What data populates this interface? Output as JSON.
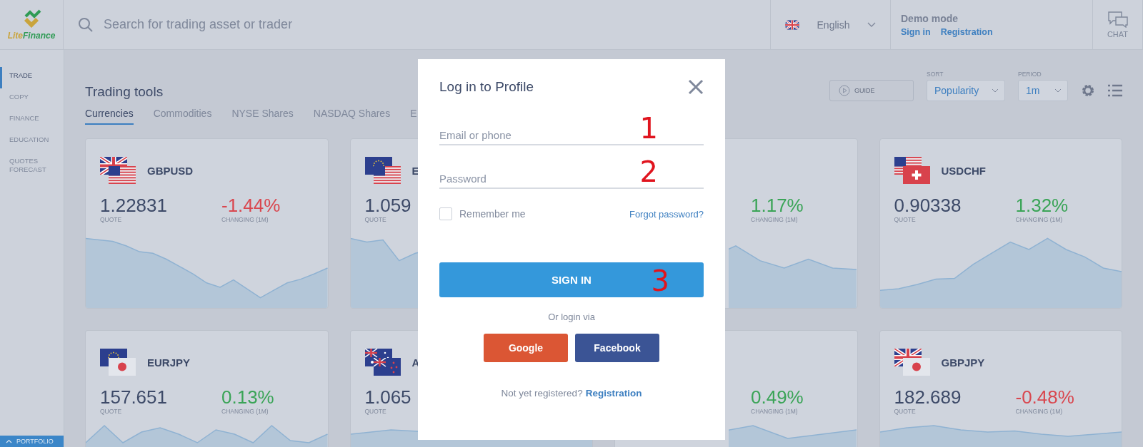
{
  "logo": {
    "parts": [
      "Lite",
      "Finance"
    ]
  },
  "search": {
    "placeholder": "Search for trading asset or trader"
  },
  "language": {
    "label": "English"
  },
  "account": {
    "mode": "Demo mode",
    "links": [
      "Sign in",
      "Registration"
    ]
  },
  "chat": {
    "label": "CHAT"
  },
  "sidebar": {
    "items": [
      {
        "label": "TRADE",
        "selected": true
      },
      {
        "label": "COPY",
        "selected": false
      },
      {
        "label": "FINANCE",
        "selected": false
      },
      {
        "label": "EDUCATION",
        "selected": false
      },
      {
        "label": "QUOTES FORECAST",
        "selected": false
      }
    ]
  },
  "portfolio": {
    "label": "PORTFOLIO"
  },
  "page": {
    "title": "Trading tools"
  },
  "tabs": [
    {
      "label": "Currencies",
      "selected": true
    },
    {
      "label": "Commodities",
      "selected": false
    },
    {
      "label": "NYSE Shares",
      "selected": false
    },
    {
      "label": "NASDAQ Shares",
      "selected": false
    },
    {
      "label": "E",
      "selected": false
    }
  ],
  "toolbar": {
    "guide": "GUIDE",
    "sort_label": "SORT",
    "sort_value": "Popularity",
    "period_label": "PERIOD",
    "period_value": "1m"
  },
  "cards": [
    {
      "pair": "GBPUSD",
      "quote": "1.22831",
      "quote_label": "QUOTE",
      "change": "-1.44%",
      "change_label": "CHANGING (1M)",
      "color": "#d9474f"
    },
    {
      "pair": "E",
      "quote": "1.059",
      "quote_label": "QUOTE"
    },
    {
      "change": "1.17%",
      "change_label": "CHANGING (1M)",
      "color": "#3aa457"
    },
    {
      "pair": "USDCHF",
      "quote": "0.90338",
      "quote_label": "QUOTE",
      "change": "1.32%",
      "change_label": "CHANGING (1M)",
      "color": "#3aa457"
    },
    {
      "pair": "EURJPY",
      "quote": "157.651",
      "quote_label": "QUOTE",
      "change": "0.13%",
      "change_label": "CHANGING (1M)",
      "color": "#3aa457"
    },
    {
      "pair": "A",
      "quote": "1.065",
      "quote_label": "QUOTE"
    },
    {
      "change": "0.49%",
      "change_label": "CHANGING (1M)",
      "color": "#3aa457"
    },
    {
      "pair": "GBPJPY",
      "quote": "182.689",
      "quote_label": "QUOTE",
      "change": "-0.48%",
      "change_label": "CHANGING (1M)",
      "color": "#d9474f"
    }
  ],
  "dialog": {
    "title": "Log in to Profile",
    "fields": [
      {
        "placeholder": "Email or phone",
        "marker": "1"
      },
      {
        "placeholder": "Password",
        "marker": "2"
      }
    ],
    "remember": {
      "label": "Remember me",
      "checked": false
    },
    "forgot": "Forgot password?",
    "submit": {
      "label": "SIGN IN",
      "marker": "3"
    },
    "alt_text": "Or login via",
    "social": [
      {
        "label": "Google",
        "color": "#db5634"
      },
      {
        "label": "Facebook",
        "color": "#3b5495"
      }
    ],
    "footer_text": "Not yet registered?",
    "footer_link": "Registration"
  }
}
